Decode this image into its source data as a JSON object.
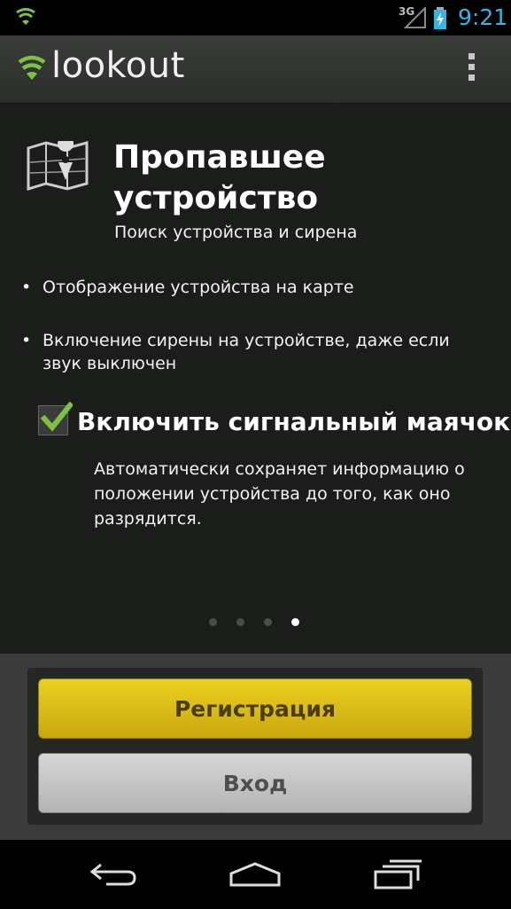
{
  "status_bar": {
    "network": "3G",
    "time": "9:21"
  },
  "action_bar": {
    "app_name": "lookout",
    "menu_icon": "overflow-menu-icon"
  },
  "feature": {
    "icon": "map-pin-icon",
    "title": "Пропавшее устройство",
    "subtitle": "Поиск устройства и сирена",
    "bullets": [
      "Отображение устройства на карте",
      "Включение сирены на устройстве, даже если звук выключен"
    ],
    "bullet_mark": "•"
  },
  "beacon": {
    "checked": true,
    "label": "Включить сигнальный маячок",
    "description": "Автоматически сохраняет информацию о положении устройства до того, как оно разрядится."
  },
  "pager": {
    "total": 4,
    "current": 4
  },
  "buttons": {
    "register": "Регистрация",
    "login": "Вход"
  },
  "colors": {
    "accent_green": "#7dc242",
    "time_blue": "#33b5e5",
    "register_yellow": "#e2c218"
  }
}
